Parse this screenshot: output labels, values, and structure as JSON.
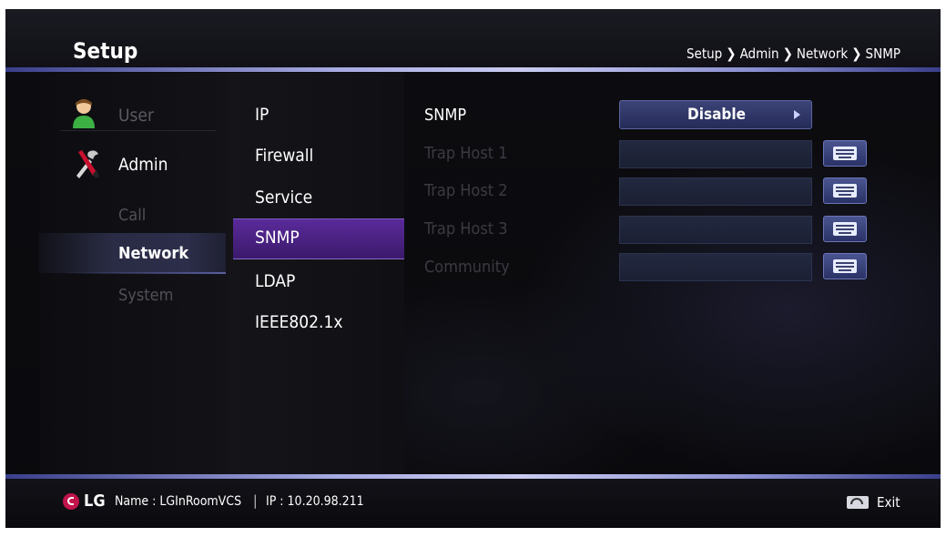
{
  "header": {
    "title": "Setup",
    "breadcrumb": [
      "Setup",
      "Admin",
      "Network",
      "SNMP"
    ]
  },
  "left_menu": {
    "items": [
      {
        "label": "User",
        "icon": "user-icon"
      },
      {
        "label": "Admin",
        "icon": "tools-icon"
      }
    ],
    "sub_items": [
      "Call",
      "Network",
      "System"
    ],
    "selected": "Network"
  },
  "middle_menu": {
    "items": [
      "IP",
      "Firewall",
      "Service",
      "SNMP",
      "LDAP",
      "IEEE802.1x"
    ],
    "selected": "SNMP"
  },
  "settings": {
    "snmp_label": "SNMP",
    "snmp_value": "Disable",
    "trap_host_1_label": "Trap Host 1",
    "trap_host_2_label": "Trap Host 2",
    "trap_host_3_label": "Trap Host 3",
    "community_label": "Community"
  },
  "footer": {
    "brand": "LG",
    "name": "Name : LGInRoomVCS",
    "ip": "IP : 10.20.98.211",
    "exit_label": "Exit"
  },
  "colors": {
    "accent_purple": "#5a2a9a",
    "selection_blue": "#2c2e4a",
    "lg_red": "#c0144a"
  }
}
